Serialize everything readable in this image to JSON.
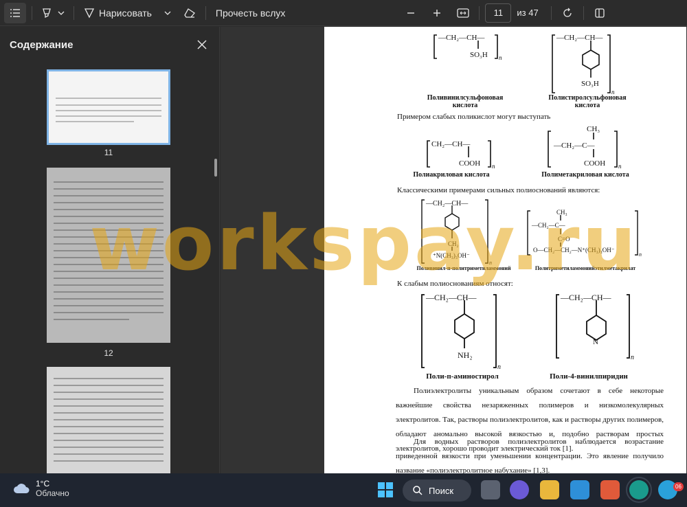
{
  "toolbar": {
    "draw_label": "Нарисовать",
    "read_aloud_label": "Прочесть вслух",
    "page_number": "11",
    "page_of": "из 47"
  },
  "sidebar": {
    "title": "Содержание",
    "thumbnails": [
      {
        "label": "11"
      },
      {
        "label": "12"
      }
    ]
  },
  "document": {
    "struct_1_name": "Поливинилсульфоновая кислота",
    "struct_2_name": "Полистиролсульфоновая кислота",
    "weak_acids_intro": "Примером слабых поликислот могут выступать",
    "struct_3_name": "Полиакриловая кислота",
    "struct_4_name": "Полиметакриловая кислота",
    "strong_bases_intro": "Классическими примерами сильных полиоснований являются:",
    "struct_5_name": "Поливинил-п-политриметиламмоний",
    "struct_6_name": "Политриметиламмонийэтилметакрилат",
    "weak_bases_intro": "К слабым полиоснованиям относят:",
    "struct_7_name": "Поли-п-аминостирол",
    "struct_8_name": "Поли-4-винилпиридин",
    "paragraph_1": "Полиэлектролиты уникальным образом сочетают в себе некоторые важнейшие свойства незаряженных полимеров и низкомолекулярных электролитов. Так, растворы полиэлектролитов, как и растворы других полимеров, обладают аномально высокой вязкостью и, подобно растворам простых электролитов, хорошо проводит электрический ток [1].",
    "paragraph_2": "Для водных растворов полиэлектролитов наблюдается возрастание приведенной вязкости при уменьшении концентрации. Это явление получило название «полиэлектролитное набухание» [1,3]."
  },
  "watermark": "workspay.ru",
  "taskbar": {
    "temperature": "1°C",
    "weather": "Облачно",
    "search_label": "Поиск",
    "badge_count": "06"
  }
}
